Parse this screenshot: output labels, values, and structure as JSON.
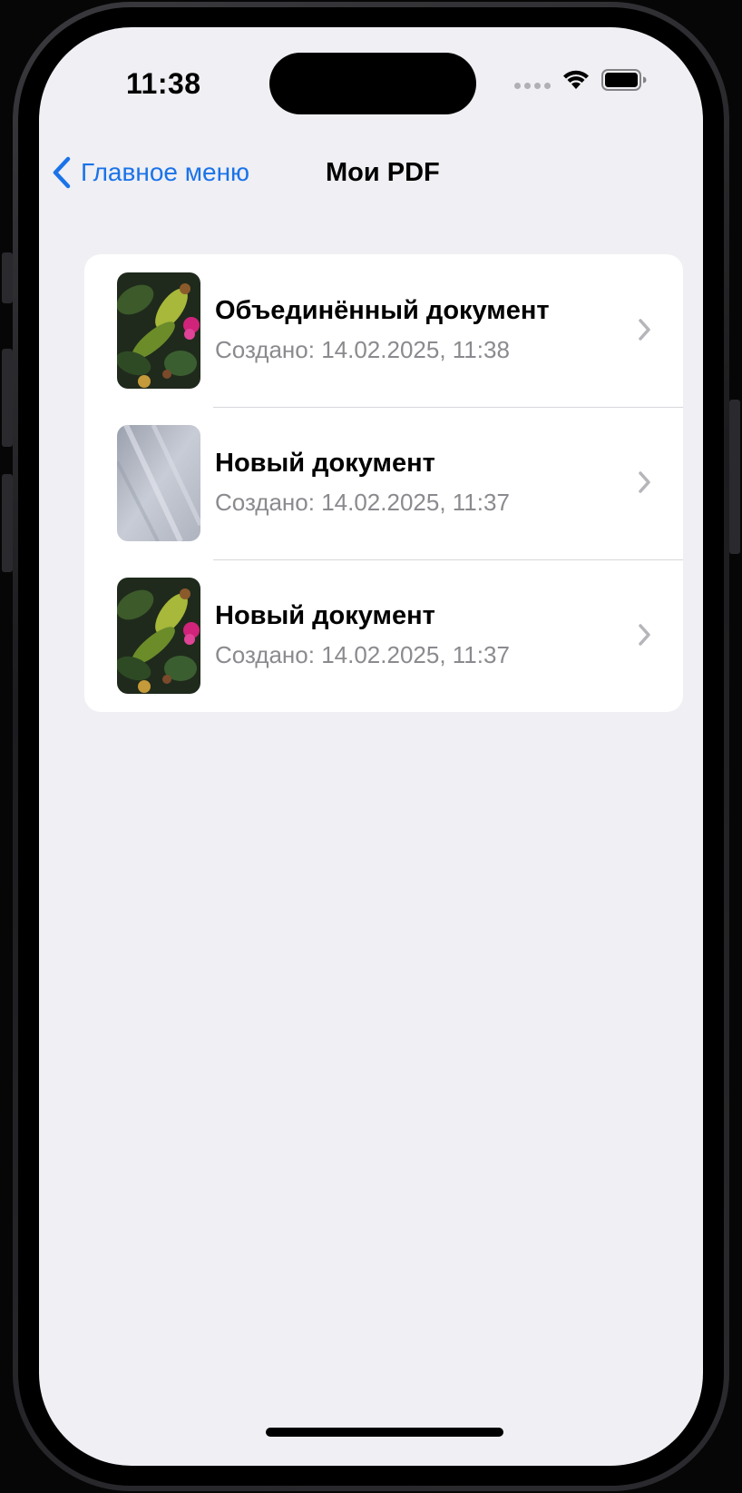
{
  "status_bar": {
    "time": "11:38"
  },
  "nav": {
    "back_label": "Главное меню",
    "title": "Мои PDF"
  },
  "documents": [
    {
      "title": "Объединённый документ",
      "subtitle": "Создано: 14.02.2025, 11:38",
      "thumbnail": "floral-photo"
    },
    {
      "title": "Новый документ",
      "subtitle": "Создано: 14.02.2025, 11:37",
      "thumbnail": "gray-gradient"
    },
    {
      "title": "Новый документ",
      "subtitle": "Создано: 14.02.2025, 11:37",
      "thumbnail": "floral-photo"
    }
  ],
  "icons": {
    "back": "chevron-left-icon",
    "row_disclosure": "chevron-right-icon",
    "wifi": "wifi-icon",
    "battery": "battery-icon",
    "cellular": "cellular-signal-icon"
  },
  "colors": {
    "accent": "#1a73e8",
    "background": "#efeff4",
    "card": "#ffffff",
    "secondary_text": "#8a8a8f",
    "separator": "#d7d7dc"
  }
}
